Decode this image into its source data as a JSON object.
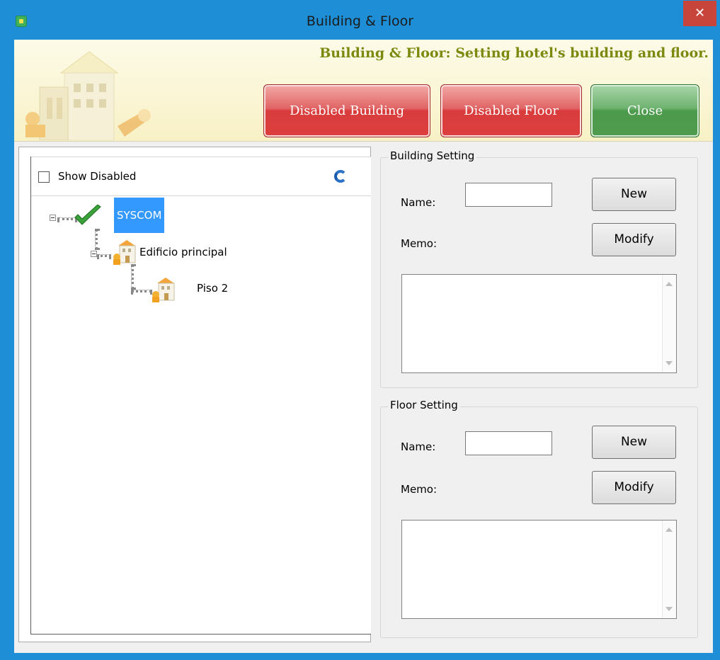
{
  "window": {
    "title": "Building & Floor",
    "close_glyph": "✕"
  },
  "banner": {
    "text": "Building & Floor: Setting hotel's building and floor.",
    "buttons": {
      "disabled_building": "Disabled Building",
      "disabled_floor": "Disabled Floor",
      "close": "Close"
    }
  },
  "tree": {
    "show_disabled_label": "Show Disabled",
    "show_disabled_checked": false,
    "nodes": [
      {
        "label": "SYSCOM",
        "icon": "check-icon",
        "level": 0,
        "selected": true
      },
      {
        "label": "Edificio principal",
        "icon": "building-icon",
        "level": 1,
        "selected": false
      },
      {
        "label": "Piso 2",
        "icon": "building-icon",
        "level": 2,
        "selected": false
      }
    ]
  },
  "building_setting": {
    "title": "Building Setting",
    "name_label": "Name:",
    "name_value": "",
    "memo_label": "Memo:",
    "memo_value": "",
    "new_button": "New",
    "modify_button": "Modify"
  },
  "floor_setting": {
    "title": "Floor Setting",
    "name_label": "Name:",
    "name_value": "",
    "memo_label": "Memo:",
    "memo_value": "",
    "new_button": "New",
    "modify_button": "Modify"
  },
  "colors": {
    "accent": "#1e8fd6",
    "banner_text": "#7b8a0e",
    "danger": "#d93c3c",
    "success": "#4c9a4c",
    "selection": "#3399ff"
  }
}
